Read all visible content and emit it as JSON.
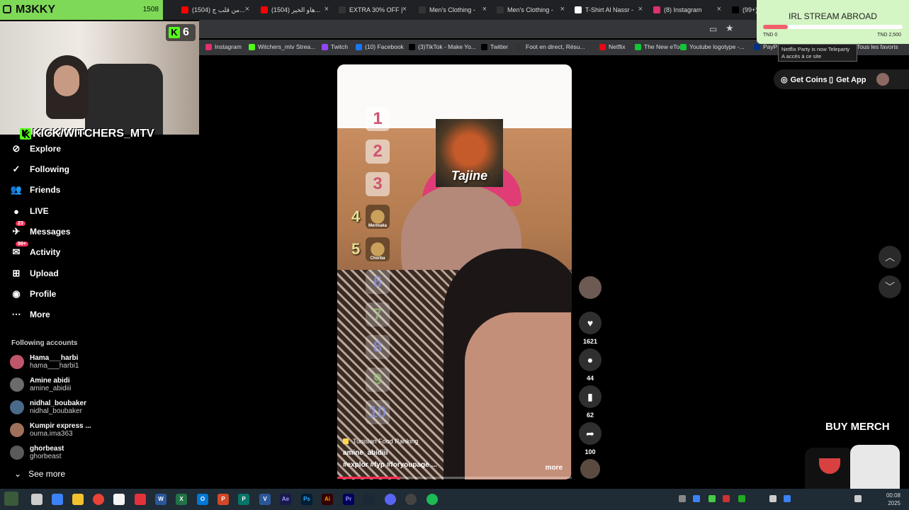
{
  "overlay": {
    "name": "M3KKY",
    "count": "1508",
    "viewers": "6",
    "kick_handle": "KICK/WITCHERS_MTV"
  },
  "tabs": [
    {
      "label": "(1504) من قلب ج...",
      "color": "#ff0000"
    },
    {
      "label": "(1504) هاو الخير...",
      "color": "#ff0000"
    },
    {
      "label": "EXTRA 30% OFF |",
      "color": "#333"
    },
    {
      "label": "Men's Clothing -",
      "color": "#333"
    },
    {
      "label": "Men's Clothing -",
      "color": "#333"
    },
    {
      "label": "T-Shirt Al Nassr -",
      "color": "#fff"
    },
    {
      "label": "(8) Instagram",
      "color": "#e1306c"
    },
    {
      "label": "(99+)",
      "color": "#000"
    }
  ],
  "bookmarks": [
    {
      "label": "Instagram",
      "color": "#e1306c"
    },
    {
      "label": "Witchers_mtv Strea...",
      "color": "#53fc18"
    },
    {
      "label": "Twitch",
      "color": "#9146ff"
    },
    {
      "label": "(10) Facebook",
      "color": "#1877f2"
    },
    {
      "label": "(3)TikTok - Make Yo...",
      "color": "#000"
    },
    {
      "label": "Twitter",
      "color": "#000"
    },
    {
      "label": "Foot en direct, Résu...",
      "color": "#333"
    },
    {
      "label": "Netflix",
      "color": "#e50914"
    },
    {
      "label": "The New eToro",
      "color": "#13c636"
    },
    {
      "label": "Youtube logotype -...",
      "color": "#13c636"
    },
    {
      "label": "PayPal",
      "color": "#003087"
    },
    {
      "label": "Tous les favoris",
      "color": "#555"
    }
  ],
  "irl_widget": {
    "title": "IRL STREAM ABROAD",
    "left_label": "TND 0",
    "right_label": "TND 2,500",
    "progress": 0.18
  },
  "tooltip": {
    "line1": "Netflix Party is now Teleparty",
    "line2": "A accès à ce site"
  },
  "topright": {
    "coins": "Get Coins",
    "app": "Get App"
  },
  "sidebar": {
    "nav": [
      {
        "label": "Explore",
        "icon": "compass-icon",
        "glyph": "⊘"
      },
      {
        "label": "Following",
        "icon": "following-icon",
        "glyph": "✓"
      },
      {
        "label": "Friends",
        "icon": "friends-icon",
        "glyph": "👥"
      },
      {
        "label": "LIVE",
        "icon": "live-icon",
        "glyph": "●"
      },
      {
        "label": "Messages",
        "icon": "messages-icon",
        "glyph": "✈",
        "badge": "23"
      },
      {
        "label": "Activity",
        "icon": "activity-icon",
        "glyph": "✉",
        "badge": "99+"
      },
      {
        "label": "Upload",
        "icon": "upload-icon",
        "glyph": "⊞"
      },
      {
        "label": "Profile",
        "icon": "profile-icon",
        "glyph": "◉"
      },
      {
        "label": "More",
        "icon": "more-icon",
        "glyph": "⋯"
      }
    ],
    "following_title": "Following accounts",
    "accounts": [
      {
        "name": "Hama___harbi",
        "user": "hama___harbi1",
        "color": "#c0566a"
      },
      {
        "name": "Amine abidi",
        "user": "amine_abidiii",
        "color": "#6b6b6b"
      },
      {
        "name": "nidhal_boubaker",
        "user": "nidhal_boubaker",
        "color": "#4a6a8a"
      },
      {
        "name": "Kumpir express ...",
        "user": "ouma.ima363",
        "color": "#a0705a"
      },
      {
        "name": "ghorbeast",
        "user": "ghorbeast",
        "color": "#5a5a5a"
      }
    ],
    "see_more": "See more"
  },
  "video": {
    "ranks": [
      "1",
      "2",
      "3",
      "",
      "",
      "6",
      "7",
      "8",
      "9",
      "10"
    ],
    "rank_side": [
      "4",
      "5"
    ],
    "thumb4": "Mermaka",
    "thumb5": "Chorba",
    "sticker": "Tajine",
    "sound": "Tunisian Food Ranking",
    "user": "amine_abidiii",
    "tags": "#explor #fyp #foryoupage ...",
    "more": "more",
    "progress": 0.27
  },
  "actions": {
    "likes": "1621",
    "comments": "44",
    "saves": "62",
    "shares": "100"
  },
  "merch": {
    "title": "BUY MERCH"
  },
  "taskbar": {
    "time": "00:08",
    "date": "2025"
  }
}
